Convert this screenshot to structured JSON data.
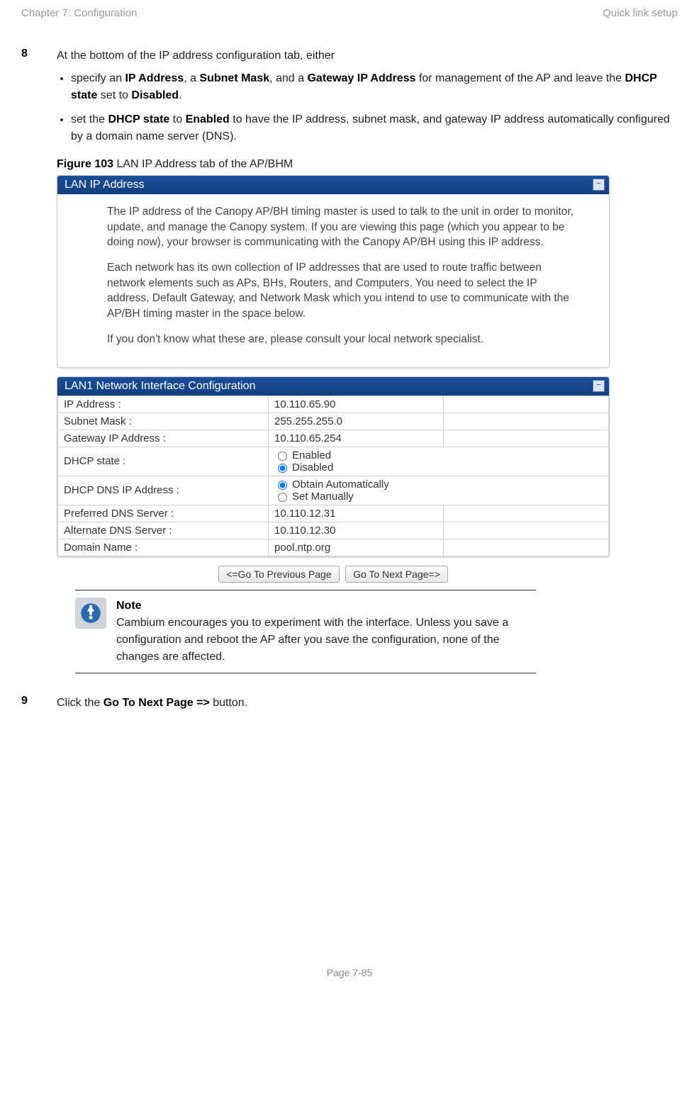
{
  "header": {
    "left": "Chapter 7:  Configuration",
    "right": "Quick link setup"
  },
  "step8": {
    "num": "8",
    "intro": "At the bottom of the IP address configuration tab, either",
    "bullet1_pre": "specify an ",
    "bullet1_b1": "IP Address",
    "bullet1_mid1": ", a ",
    "bullet1_b2": "Subnet Mask",
    "bullet1_mid2": ", and a ",
    "bullet1_b3": "Gateway IP Address",
    "bullet1_mid3": " for management of the AP and leave the ",
    "bullet1_b4": "DHCP state",
    "bullet1_mid4": " set to ",
    "bullet1_b5": "Disabled",
    "bullet1_end": ".",
    "bullet2_pre": "set the ",
    "bullet2_b1": "DHCP state",
    "bullet2_mid1": " to ",
    "bullet2_b2": "Enabled",
    "bullet2_end": " to have the IP address, subnet mask, and gateway IP address automatically configured by a domain name server (DNS)."
  },
  "figure": {
    "label": "Figure 103",
    "caption": " LAN IP Address tab of the AP/BHM"
  },
  "panel1": {
    "title": "LAN IP Address",
    "p1": "The IP address of the Canopy AP/BH timing master is used to talk to the unit in order to monitor, update, and manage the Canopy system. If you are viewing this page (which you appear to be doing now), your browser is communicating with the Canopy AP/BH using this IP address.",
    "p2": "Each network has its own collection of IP addresses that are used to route traffic between network elements such as APs, BHs, Routers, and Computers. You need to select the IP address, Default Gateway, and Network Mask which you intend to use to communicate with the AP/BH timing master in the space below.",
    "p3": "If you don't know what these are, please consult your local network specialist."
  },
  "panel2": {
    "title": "LAN1 Network Interface Configuration",
    "rows": {
      "ip_label": "IP Address :",
      "ip_val": "10.110.65.90",
      "mask_label": "Subnet Mask :",
      "mask_val": "255.255.255.0",
      "gw_label": "Gateway IP Address :",
      "gw_val": "10.110.65.254",
      "dhcp_label": "DHCP state :",
      "dhcp_opt1": "Enabled",
      "dhcp_opt2": "Disabled",
      "dns_label": "DHCP DNS IP Address :",
      "dns_opt1": "Obtain Automatically",
      "dns_opt2": "Set Manually",
      "pdns_label": "Preferred DNS Server :",
      "pdns_val": "10.110.12.31",
      "adns_label": "Alternate DNS Server :",
      "adns_val": "10.110.12.30",
      "domain_label": "Domain Name :",
      "domain_val": "pool.ntp.org"
    }
  },
  "nav": {
    "prev": "<=Go To Previous Page",
    "next": "Go To Next Page=>"
  },
  "note": {
    "title": "Note",
    "body": "Cambium encourages you to experiment with the interface. Unless you save a configuration and reboot the AP after you save the configuration, none of the changes are affected."
  },
  "step9": {
    "num": "9",
    "pre": "Click the ",
    "bold": "Go To Next Page =>",
    "post": " button."
  },
  "footer": "Page 7-85"
}
